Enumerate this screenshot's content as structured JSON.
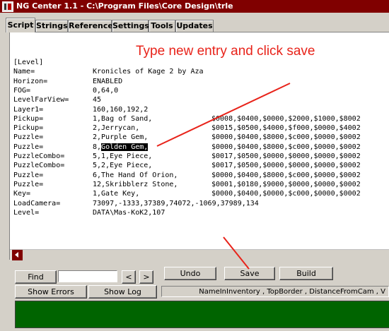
{
  "window": {
    "title": "NG Center 1.1 - C:\\Program Files\\Core Design\\trle"
  },
  "tabs": [
    {
      "label": "Script"
    },
    {
      "label": "Strings"
    },
    {
      "label": "Reference"
    },
    {
      "label": "Settings"
    },
    {
      "label": "Tools"
    },
    {
      "label": "Updates"
    }
  ],
  "annotation": "Type new entry and click save",
  "script": {
    "section": "[Level]",
    "lines": [
      [
        "Name=",
        "Kronicles of Kage 2 by Aza",
        ""
      ],
      [
        "Horizon=",
        "ENABLED",
        ""
      ],
      [
        "FOG=",
        "0,64,0",
        ""
      ],
      [
        "LevelFarView=",
        "45",
        ""
      ],
      [
        "Layer1=",
        "160,160,192,2",
        ""
      ],
      [
        "Pickup=",
        "1,Bag of Sand,",
        "$0008,$0400,$0000,$2000,$1000,$8002"
      ],
      [
        "Pickup=",
        "2,Jerrycan,",
        "$0015,$0500,$4000,$f000,$0000,$4002"
      ],
      [
        "Puzzle=",
        "2,Purple Gem,",
        "$0000,$0400,$8000,$c000,$0000,$0002"
      ],
      [
        "Puzzle=",
        "8,",
        "$0000,$0400,$8000,$c000,$0000,$0002"
      ],
      [
        "PuzzleCombo=",
        "5,1,Eye Piece,",
        "$0017,$0500,$0000,$0000,$0000,$0002"
      ],
      [
        "PuzzleCombo=",
        "5,2,Eye Piece,",
        "$0017,$0500,$0000,$0000,$0000,$0002"
      ],
      [
        "Puzzle=",
        "6,The Hand Of Orion,",
        "$0000,$0400,$8000,$c000,$0000,$0002"
      ],
      [
        "Puzzle=",
        "12,Skribblerz Stone,",
        "$0001,$0180,$9000,$0000,$0000,$0002"
      ],
      [
        "Key=",
        "1,Gate Key,",
        "$0000,$0400,$0000,$c000,$0000,$0002"
      ],
      [
        "LoadCamera=",
        "73097,-1333,37389,74072,-1069,37989,134",
        ""
      ],
      [
        "Level=",
        "DATA\\Mas-KoK2,107",
        ""
      ]
    ],
    "highlighted_entry": "Golden Gem,"
  },
  "toolbar": {
    "find_label": "Find",
    "find_value": "",
    "prev_label": "<",
    "next_label": ">",
    "undo_label": "Undo",
    "save_label": "Save",
    "build_label": "Build",
    "show_errors_label": "Show Errors",
    "show_log_label": "Show Log",
    "status_text": "NameInInventory , TopBorder , DistanceFromCam , V"
  },
  "colors": {
    "titlebar": "#800000",
    "annotation": "#e8231a",
    "log_panel": "#006400"
  }
}
